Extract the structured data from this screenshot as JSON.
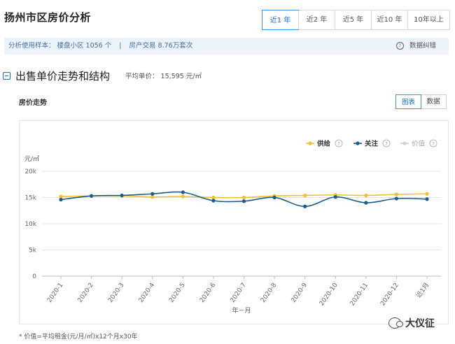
{
  "page": {
    "title": "扬州市区房价分析",
    "range_tabs": [
      "近1 年",
      "近2 年",
      "近5 年",
      "近10 年",
      "10年以上"
    ],
    "info": {
      "sample": "分析使用样本：  楼盘小区 1056 个",
      "divider": "|",
      "trades": "房产交易 8.76万套次",
      "feedback": "数据纠错"
    },
    "section": {
      "title": "出售单价走势和结构",
      "avg_price": "平均单价：  15,595 元/㎡"
    },
    "chart_subtitle": "房价走势",
    "view_tabs": [
      "图表",
      "数据"
    ],
    "footnote": "* 价值=平均租金(元/月/㎡)x12个月x30年",
    "watermark": "大仪征"
  },
  "colors": {
    "supply": "#f2c12e",
    "attention": "#1a5c8a",
    "value": "#cfcfcf",
    "accent": "#1f6fc7"
  },
  "chart_data": {
    "type": "line",
    "categories": [
      "2020-1",
      "2020-2",
      "2020-3",
      "2020-4",
      "2020-5",
      "2020-6",
      "2020-7",
      "2020-8",
      "2020-9",
      "2020-10",
      "2020-11",
      "2020-12",
      "近1月"
    ],
    "series": [
      {
        "name": "供给",
        "values": [
          15200,
          15300,
          15300,
          15100,
          15200,
          15000,
          15000,
          15300,
          15400,
          15500,
          15400,
          15600,
          15700
        ]
      },
      {
        "name": "关注",
        "values": [
          14600,
          15300,
          15400,
          15700,
          16000,
          14400,
          14300,
          15000,
          13300,
          15100,
          14000,
          14800,
          14700
        ]
      },
      {
        "name": "价值",
        "values": []
      }
    ],
    "legend_help": "?",
    "ylabel": "元/㎡",
    "xlabel": "年－月",
    "ylim": [
      0,
      20000
    ],
    "yticks": [
      "0",
      "5k",
      "10k",
      "15k",
      "20k"
    ],
    "ytick_values": [
      0,
      5000,
      10000,
      15000,
      20000
    ],
    "grid": true,
    "legend": "top-right"
  }
}
